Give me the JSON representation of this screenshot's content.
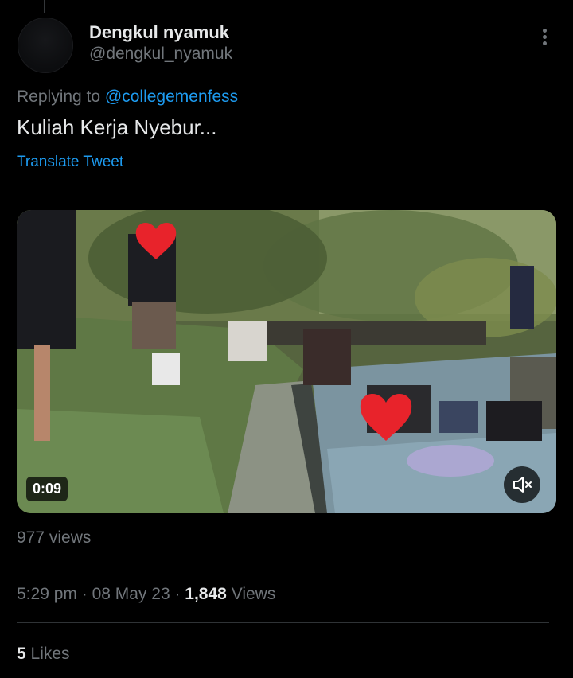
{
  "tweet": {
    "author_name": "Dengkul nyamuk",
    "author_handle": "@dengkul_nyamuk",
    "replying_prefix": "Replying to",
    "replying_to": "@collegemenfess",
    "text": "Kuliah Kerja Nyebur...",
    "translate_label": "Translate Tweet"
  },
  "media": {
    "duration": "0:09",
    "mute_icon": "speaker-muted-icon",
    "views_label": "977 views"
  },
  "meta": {
    "time": "5:29 pm",
    "sep1": " · ",
    "date": "08 May 23",
    "sep2": " · ",
    "views_count": "1,848",
    "views_word": " Views"
  },
  "engagement": {
    "likes_count": "5",
    "likes_word": " Likes"
  },
  "colors": {
    "background": "#000000",
    "text_primary": "#e7e9ea",
    "text_secondary": "#71767b",
    "link": "#1d9bf0",
    "divider": "#2f3336"
  }
}
